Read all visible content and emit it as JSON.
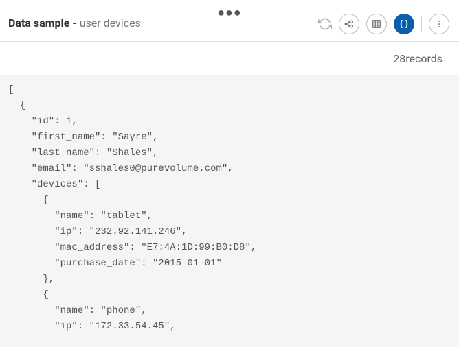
{
  "header": {
    "title_prefix": "Data sample - ",
    "title_suffix": "user devices"
  },
  "records": {
    "count": 28,
    "label_suffix": " records"
  },
  "view_buttons": {
    "schema": "schema-view",
    "table": "table-view",
    "json": "json-view",
    "menu": "menu"
  },
  "sample_data": [
    {
      "id": 1,
      "first_name": "Sayre",
      "last_name": "Shales",
      "email": "sshales0@purevolume.com",
      "devices": [
        {
          "name": "tablet",
          "ip": "232.92.141.246",
          "mac_address": "E7:4A:1D:99:B0:D8",
          "purchase_date": "2015-01-01"
        },
        {
          "name": "phone",
          "ip": "172.33.54.45"
        }
      ]
    }
  ]
}
